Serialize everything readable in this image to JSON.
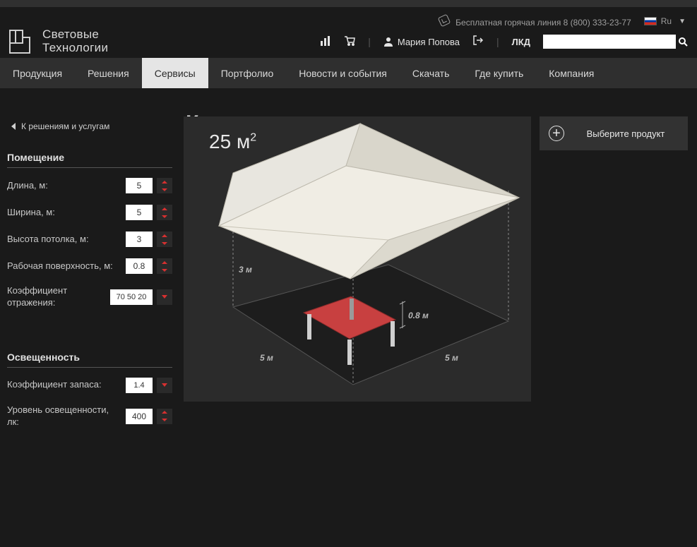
{
  "header": {
    "hotline": "Бесплатная горячая линия 8 (800) 333-23-77",
    "lang": "Ru",
    "user_name": "Мария Попова",
    "lkd": "ЛКД"
  },
  "logo": {
    "line1": "Световые",
    "line2": "Технологии"
  },
  "nav": [
    {
      "label": "Продукция",
      "active": false
    },
    {
      "label": "Решения",
      "active": false
    },
    {
      "label": "Сервисы",
      "active": true
    },
    {
      "label": "Портфолио",
      "active": false
    },
    {
      "label": "Новости и события",
      "active": false
    },
    {
      "label": "Скачать",
      "active": false
    },
    {
      "label": "Где купить",
      "active": false
    },
    {
      "label": "Компания",
      "active": false
    }
  ],
  "back_link": "К решениям и услугам",
  "page_title": "Калькулятор освещенности",
  "sidebar": {
    "section_room": "Помещение",
    "length_label": "Длина, м:",
    "length_value": "5",
    "width_label": "Ширина, м:",
    "width_value": "5",
    "height_label": "Высота потолка, м:",
    "height_value": "3",
    "surface_label": "Рабочая поверхность, м:",
    "surface_value": "0.8",
    "reflect_label": "Коэффициент отражения:",
    "reflect_value": "70 50 20",
    "section_light": "Освещенность",
    "reserve_label": "Коэффициент запаса:",
    "reserve_value": "1.4",
    "level_label": "Уровень освещенности, лк:",
    "level_value": "400"
  },
  "canvas": {
    "area_value": "25",
    "area_unit_base": "м",
    "area_unit_exp": "2",
    "dim_height": "3 м",
    "dim_surface": "0.8 м",
    "dim_length": "5 м",
    "dim_width": "5 м"
  },
  "product_button": "Выберите продукт"
}
